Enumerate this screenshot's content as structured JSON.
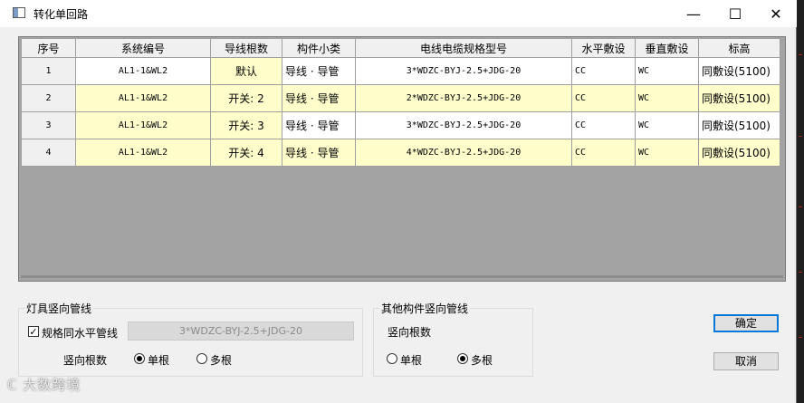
{
  "window": {
    "title": "转化单回路"
  },
  "controls": {
    "minimize": "—",
    "maximize": "☐",
    "close": "✕"
  },
  "grid": {
    "headers": [
      "序号",
      "系统编号",
      "导线根数",
      "构件小类",
      "电线电缆规格型号",
      "水平敷设",
      "垂直敷设",
      "标高"
    ],
    "rows": [
      {
        "no": "1",
        "system": "AL1-1&WL2",
        "wires": "默认",
        "type": "导线 · 导管",
        "spec": "3*WDZC-BYJ-2.5+JDG-20",
        "horizontal": "CC",
        "vertical": "WC",
        "elevation": "同敷设(5100)"
      },
      {
        "no": "2",
        "system": "AL1-1&WL2",
        "wires": "开关: 2",
        "type": "导线 · 导管",
        "spec": "2*WDZC-BYJ-2.5+JDG-20",
        "horizontal": "CC",
        "vertical": "WC",
        "elevation": "同敷设(5100)"
      },
      {
        "no": "3",
        "system": "AL1-1&WL2",
        "wires": "开关: 3",
        "type": "导线 · 导管",
        "spec": "3*WDZC-BYJ-2.5+JDG-20",
        "horizontal": "CC",
        "vertical": "WC",
        "elevation": "同敷设(5100)"
      },
      {
        "no": "4",
        "system": "AL1-1&WL2",
        "wires": "开关: 4",
        "type": "导线 · 导管",
        "spec": "4*WDZC-BYJ-2.5+JDG-20",
        "horizontal": "CC",
        "vertical": "WC",
        "elevation": "同敷设(5100)"
      }
    ]
  },
  "lamp_group": {
    "legend": "灯具竖向管线",
    "same_spec_label": "规格同水平管线",
    "same_spec_checked": true,
    "spec_value": "3*WDZC-BYJ-2.5+JDG-20",
    "count_label": "竖向根数",
    "single": "单根",
    "multi": "多根",
    "selected": "single"
  },
  "other_group": {
    "legend": "其他构件竖向管线",
    "count_label": "竖向根数",
    "single": "单根",
    "multi": "多根",
    "selected": "multi"
  },
  "buttons": {
    "ok": "确定",
    "cancel": "取消"
  },
  "watermark": "大数跨境"
}
